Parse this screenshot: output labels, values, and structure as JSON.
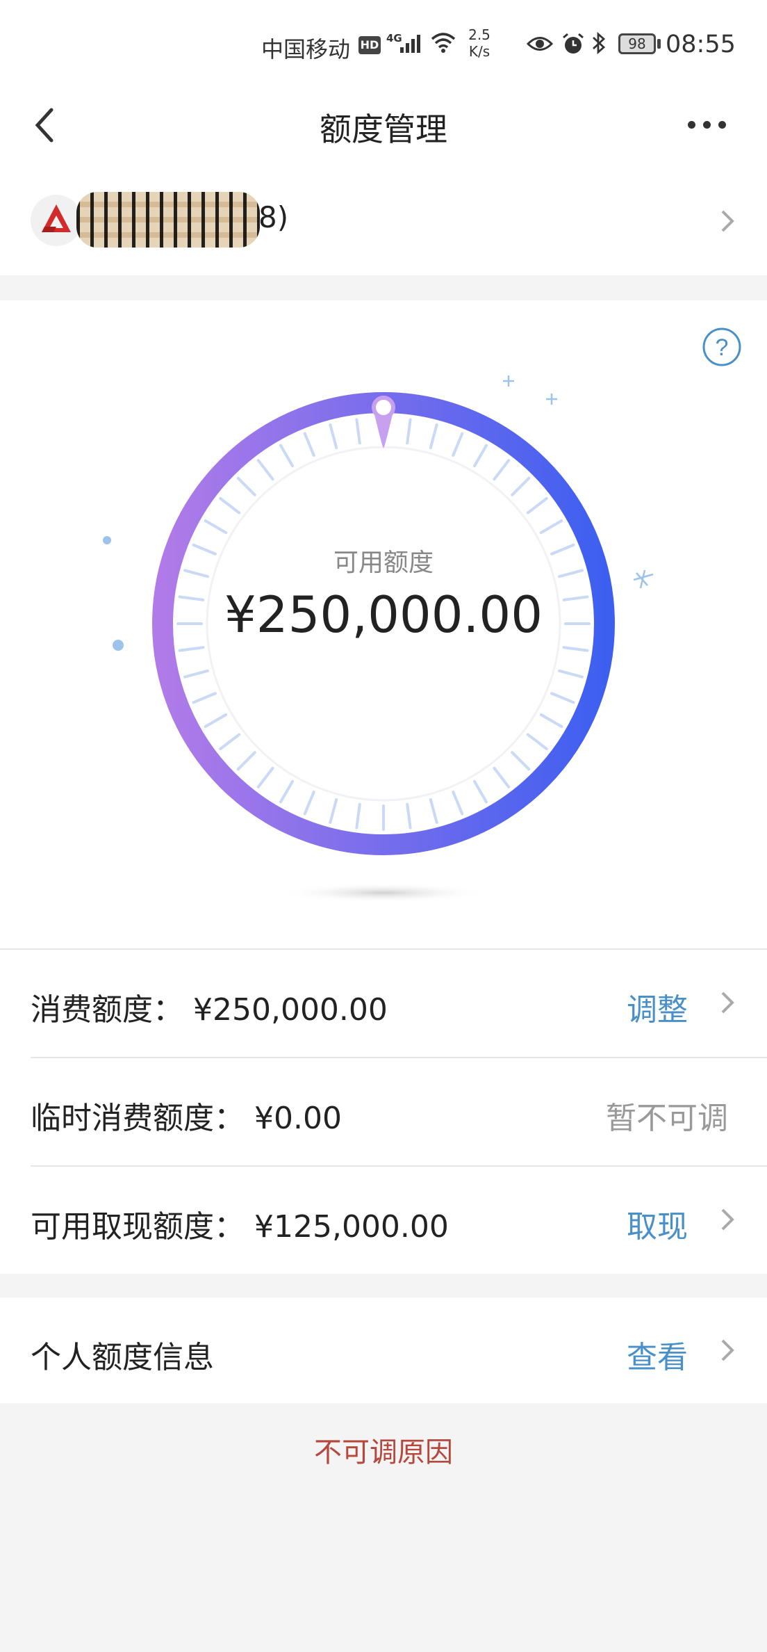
{
  "status_bar": {
    "carrier": "中国移动",
    "hd": "HD",
    "network": "4G",
    "speed_value": "2.5",
    "speed_unit": "K/s",
    "battery": "98",
    "time": "08:55"
  },
  "nav": {
    "title": "额度管理"
  },
  "card": {
    "suffix": "8)"
  },
  "dial": {
    "label": "可用额度",
    "amount": "¥250,000.00"
  },
  "limits": [
    {
      "label": "消费额度：  ¥250,000.00",
      "action": "调整"
    },
    {
      "label": "临时消费额度：  ¥0.00",
      "action": "暂不可调"
    },
    {
      "label": "可用取现额度：  ¥125,000.00",
      "action": "取现"
    }
  ],
  "personal": {
    "label": "个人额度信息",
    "action": "查看"
  },
  "reason_link": "不可调原因",
  "colors": {
    "accent_blue": "#4a90c8",
    "warning_red": "#b5473c",
    "ring_start": "#b07be8",
    "ring_end": "#3d5ff0"
  }
}
